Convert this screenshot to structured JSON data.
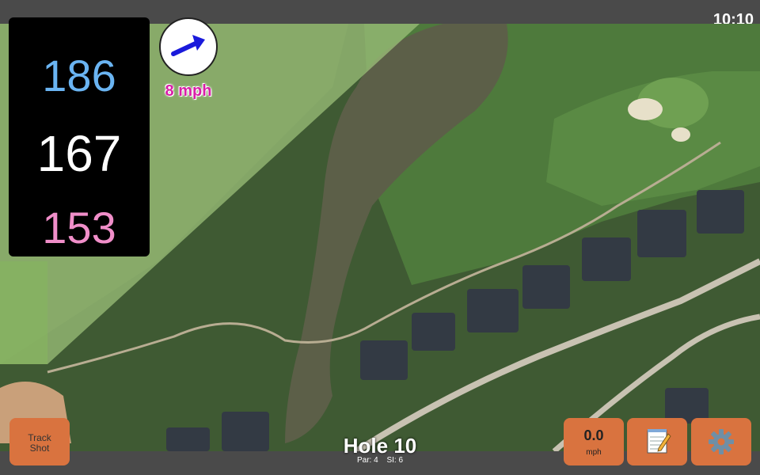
{
  "status": {
    "time": "10:10"
  },
  "distances": {
    "back": "186",
    "middle": "167",
    "front": "153"
  },
  "wind": {
    "speed_label": "8 mph",
    "direction_icon": "arrow-right-icon"
  },
  "hole": {
    "title": "Hole 10",
    "par": "Par: 4",
    "stroke_index": "SI: 6"
  },
  "buttons": {
    "track_line1": "Track",
    "track_line2": "Shot",
    "wind_value": "0.0",
    "wind_unit": "mph",
    "notes_icon": "notepad-icon",
    "settings_icon": "gear-icon"
  },
  "colors": {
    "back": "#6ab4f2",
    "middle": "#ffffff",
    "front": "#f08ec9",
    "button": "#d9733f",
    "wind_text": "#d81fa7"
  }
}
